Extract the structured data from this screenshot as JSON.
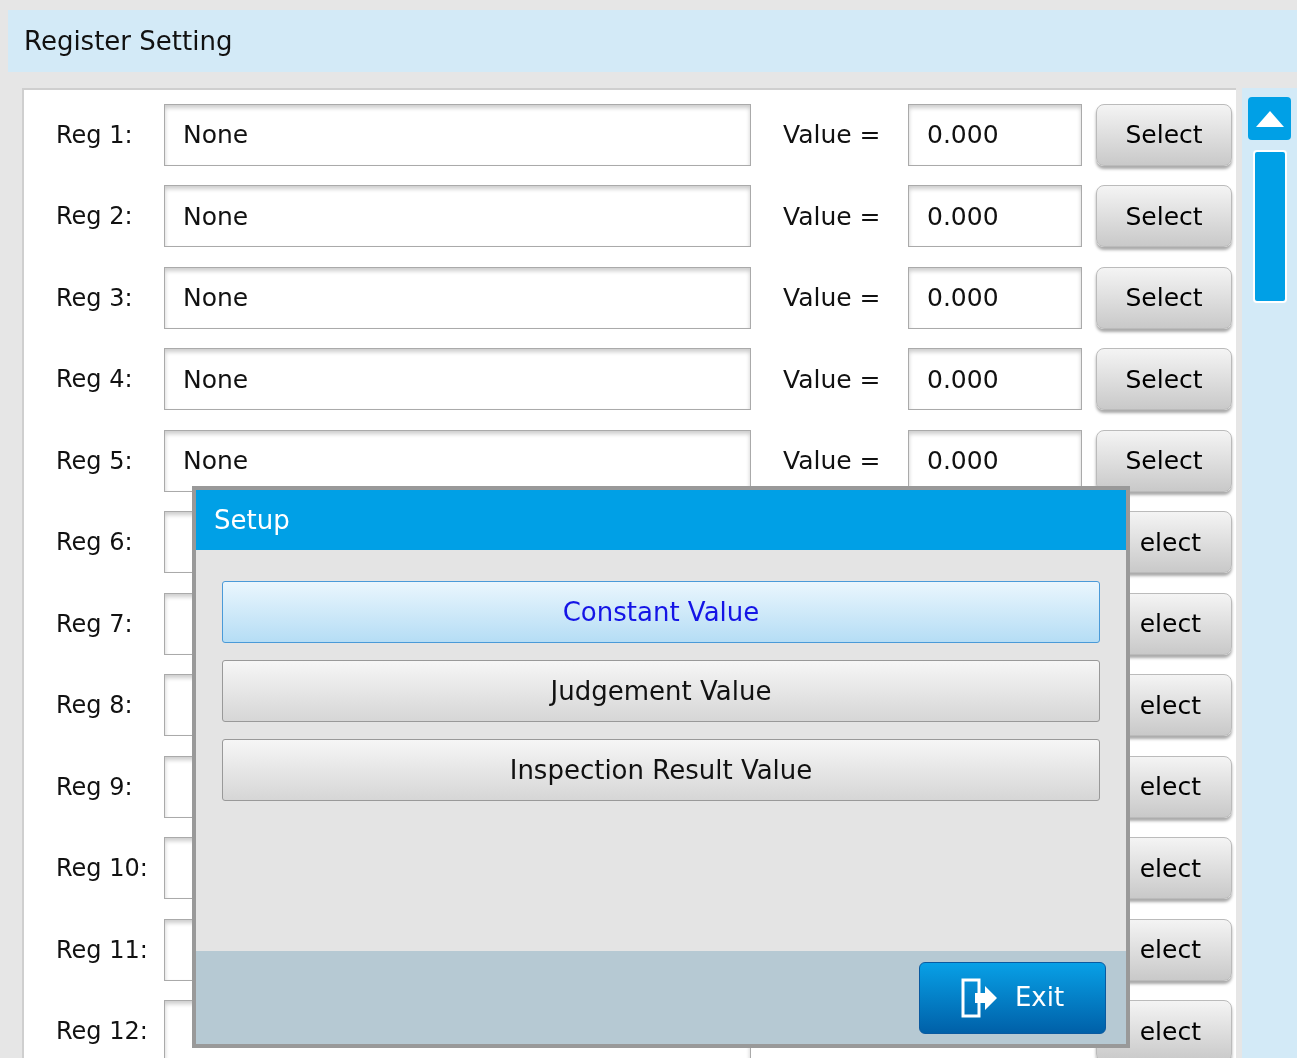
{
  "header": {
    "title": "Register Setting"
  },
  "registers": [
    {
      "label": "Reg 1:",
      "field": "None",
      "value_label": "Value =",
      "value": "0.000",
      "button": "Select"
    },
    {
      "label": "Reg 2:",
      "field": "None",
      "value_label": "Value =",
      "value": "0.000",
      "button": "Select"
    },
    {
      "label": "Reg 3:",
      "field": "None",
      "value_label": "Value =",
      "value": "0.000",
      "button": "Select"
    },
    {
      "label": "Reg 4:",
      "field": "None",
      "value_label": "Value =",
      "value": "0.000",
      "button": "Select"
    },
    {
      "label": "Reg 5:",
      "field": "None",
      "value_label": "Value =",
      "value": "0.000",
      "button": "Select"
    },
    {
      "label": "Reg 6:",
      "button": "elect"
    },
    {
      "label": "Reg 7:",
      "button": "elect"
    },
    {
      "label": "Reg 8:",
      "button": "elect"
    },
    {
      "label": "Reg 9:",
      "button": "elect"
    },
    {
      "label": "Reg 10:",
      "button": "elect"
    },
    {
      "label": "Reg 11:",
      "button": "elect"
    },
    {
      "label": "Reg 12:",
      "button": "elect"
    }
  ],
  "dialog": {
    "title": "Setup",
    "options": [
      {
        "label": "Constant Value",
        "selected": true
      },
      {
        "label": "Judgement Value",
        "selected": false
      },
      {
        "label": "Inspection Result Value",
        "selected": false
      }
    ],
    "exit_button": "Exit"
  }
}
